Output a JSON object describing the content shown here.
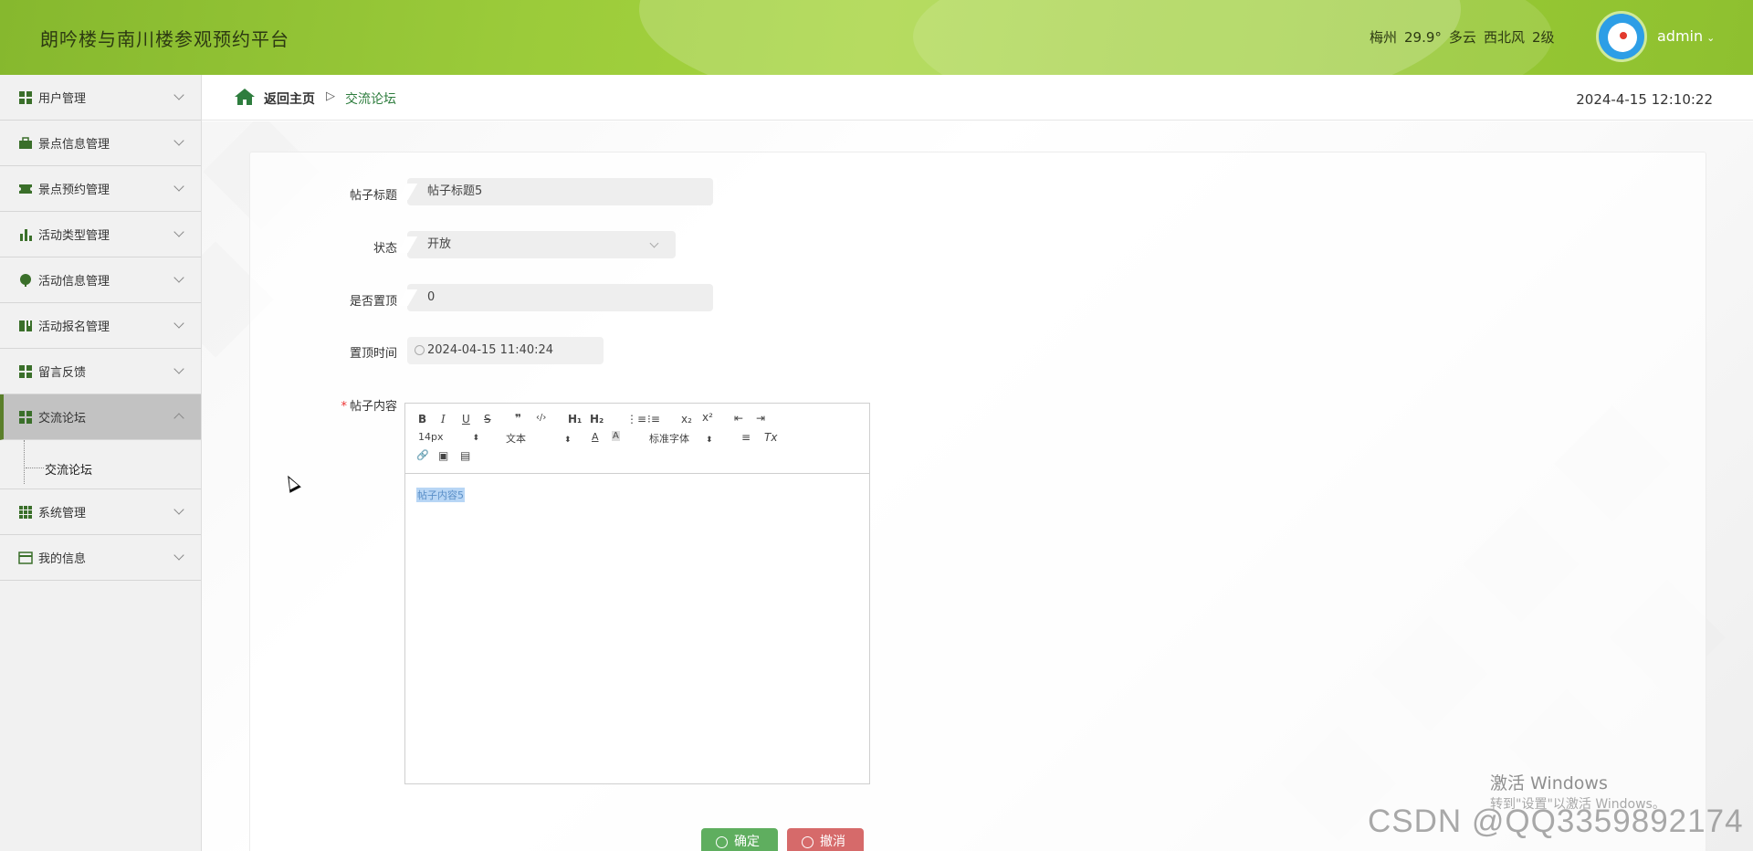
{
  "header": {
    "title": "朗吟楼与南川楼参观预约平台",
    "weather": {
      "city": "梅州",
      "temp": "29.9°",
      "condition": "多云",
      "wind": "西北风",
      "level": "2级"
    },
    "username": "admin",
    "caret": "⌄"
  },
  "sidebar": {
    "items": [
      {
        "label": "用户管理",
        "icon": "grid-icon"
      },
      {
        "label": "景点信息管理",
        "icon": "briefcase-icon"
      },
      {
        "label": "景点预约管理",
        "icon": "ticket-icon"
      },
      {
        "label": "活动类型管理",
        "icon": "bar-chart-icon"
      },
      {
        "label": "活动信息管理",
        "icon": "leaf-icon"
      },
      {
        "label": "活动报名管理",
        "icon": "book-icon"
      },
      {
        "label": "留言反馈",
        "icon": "grid-icon"
      },
      {
        "label": "交流论坛",
        "icon": "grid-icon",
        "active": true
      },
      {
        "label": "系统管理",
        "icon": "apps-icon"
      },
      {
        "label": "我的信息",
        "icon": "card-icon"
      }
    ],
    "submenu_label": "交流论坛"
  },
  "breadcrumb": {
    "home": "返回主页",
    "sep": "▷",
    "current": "交流论坛"
  },
  "clock": "2024-4-15 12:10:22",
  "form": {
    "title_label": "帖子标题",
    "title_value": "帖子标题5",
    "status_label": "状态",
    "status_value": "开放",
    "top_label": "是否置顶",
    "top_value": "0",
    "top_time_label": "置顶时间",
    "top_time_value": "2024-04-15 11:40:24",
    "content_label": "帖子内容",
    "required_mark": "*",
    "content_value": "帖子内容5"
  },
  "editor_toolbar": {
    "bold": "B",
    "italic": "I",
    "underline": "U",
    "strike": "S",
    "quote": "❞",
    "code": "‹/›",
    "h1": "H₁",
    "h2": "H₂",
    "ol": "⋮≡",
    "ul": "⁝≡",
    "sub": "x₂",
    "sup": "x²",
    "outdent": "⇤",
    "indent": "⇥",
    "size": "14px",
    "format": "文本",
    "font": "标准字体",
    "font_color": "A",
    "bg_color": "A",
    "align": "≡",
    "clean": "Tx",
    "link": "🔗",
    "image": "▣",
    "video": "▤",
    "updown": "⬍"
  },
  "buttons": {
    "ok": "确定",
    "cancel": "撤消"
  },
  "watermarks": {
    "win_line1": "激活 Windows",
    "win_line2": "转到\"设置\"以激活 Windows。",
    "csdn": "CSDN @QQ3359892174"
  },
  "colors": {
    "accent": "#9bcb3a",
    "ok": "#5fae5f",
    "cancel": "#d66a6a",
    "link": "#2e7d3e"
  }
}
